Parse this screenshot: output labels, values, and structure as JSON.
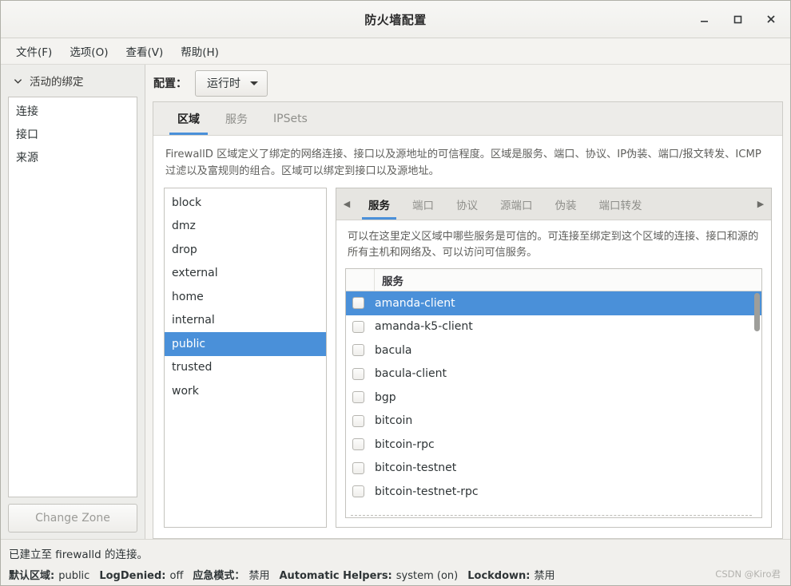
{
  "window": {
    "title": "防火墙配置",
    "controls": [
      {
        "name": "minimize-button",
        "icon": "minimize-icon"
      },
      {
        "name": "maximize-button",
        "icon": "maximize-icon"
      },
      {
        "name": "close-button",
        "icon": "close-icon"
      }
    ]
  },
  "menubar": {
    "items": [
      {
        "label": "文件(F)"
      },
      {
        "label": "选项(O)"
      },
      {
        "label": "查看(V)"
      },
      {
        "label": "帮助(H)"
      }
    ]
  },
  "sidebar": {
    "header": "活动的绑定",
    "header_icon": "chevron-down-icon",
    "items": [
      {
        "label": "连接"
      },
      {
        "label": "接口"
      },
      {
        "label": "来源"
      }
    ],
    "change_zone_button": "Change Zone"
  },
  "config_bar": {
    "label": "配置：",
    "selected": "运行时",
    "dropdown_icon": "chevron-down-icon"
  },
  "main_tabs": [
    {
      "label": "区域",
      "active": true
    },
    {
      "label": "服务",
      "active": false
    },
    {
      "label": "IPSets",
      "active": false
    }
  ],
  "zone_description": "FirewallD 区域定义了绑定的网络连接、接口以及源地址的可信程度。区域是服务、端口、协议、IP伪装、端口/报文转发、ICMP过滤以及富规则的组合。区域可以绑定到接口以及源地址。",
  "zones": [
    {
      "label": "block",
      "selected": false
    },
    {
      "label": "dmz",
      "selected": false
    },
    {
      "label": "drop",
      "selected": false
    },
    {
      "label": "external",
      "selected": false
    },
    {
      "label": "home",
      "selected": false
    },
    {
      "label": "internal",
      "selected": false
    },
    {
      "label": "public",
      "selected": true
    },
    {
      "label": "trusted",
      "selected": false
    },
    {
      "label": "work",
      "selected": false
    }
  ],
  "inner_tabs": {
    "prev_icon": "chevron-left-icon",
    "next_icon": "chevron-right-icon",
    "items": [
      {
        "label": "服务",
        "active": true
      },
      {
        "label": "端口",
        "active": false
      },
      {
        "label": "协议",
        "active": false
      },
      {
        "label": "源端口",
        "active": false
      },
      {
        "label": "伪装",
        "active": false
      },
      {
        "label": "端口转发",
        "active": false
      }
    ]
  },
  "services_description": "可以在这里定义区域中哪些服务是可信的。可连接至绑定到这个区域的连接、接口和源的所有主机和网络及、可以访问可信服务。",
  "services_table": {
    "column_header": "服务",
    "rows": [
      {
        "label": "amanda-client",
        "checked": false,
        "selected": true
      },
      {
        "label": "amanda-k5-client",
        "checked": false,
        "selected": false
      },
      {
        "label": "bacula",
        "checked": false,
        "selected": false
      },
      {
        "label": "bacula-client",
        "checked": false,
        "selected": false
      },
      {
        "label": "bgp",
        "checked": false,
        "selected": false
      },
      {
        "label": "bitcoin",
        "checked": false,
        "selected": false
      },
      {
        "label": "bitcoin-rpc",
        "checked": false,
        "selected": false
      },
      {
        "label": "bitcoin-testnet",
        "checked": false,
        "selected": false
      },
      {
        "label": "bitcoin-testnet-rpc",
        "checked": false,
        "selected": false
      }
    ]
  },
  "statusbar": {
    "connection_message": "已建立至 firewalld 的连接。",
    "fields": [
      {
        "key": "默认区域:",
        "value": "public"
      },
      {
        "key": "LogDenied:",
        "value": "off"
      },
      {
        "key": "应急模式：",
        "value": "禁用"
      },
      {
        "key": "Automatic Helpers:",
        "value": "system (on)"
      },
      {
        "key": "Lockdown:",
        "value": "禁用"
      }
    ],
    "watermark": "CSDN @Kiro君"
  },
  "colors": {
    "accent": "#4a90d9",
    "window_bg": "#f4f3f0",
    "text": "#2e3436"
  }
}
